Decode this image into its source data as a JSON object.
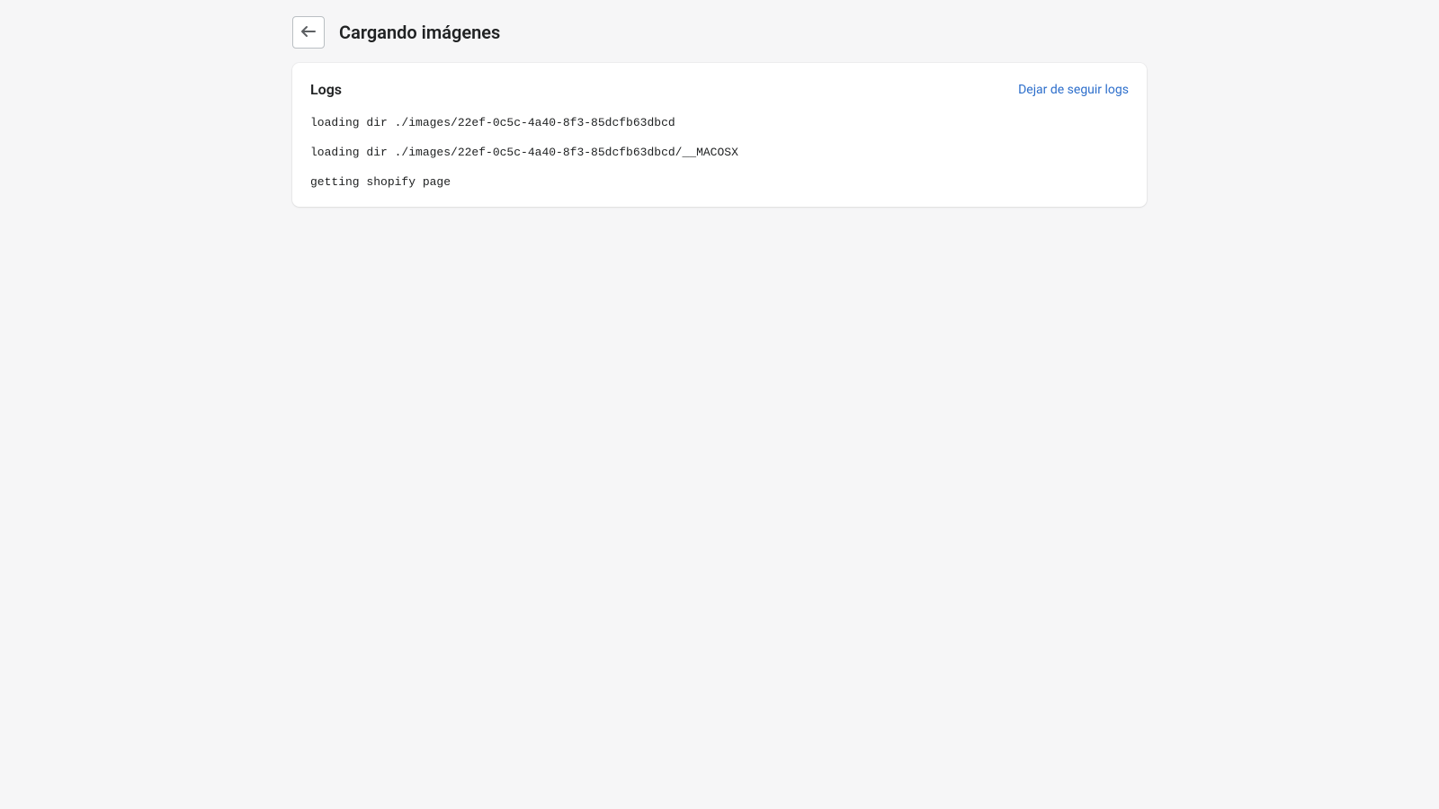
{
  "header": {
    "title": "Cargando imágenes"
  },
  "card": {
    "title": "Logs",
    "action_label": "Dejar de seguir logs"
  },
  "logs": [
    "loading dir ./images/22ef-0c5c-4a40-8f3-85dcfb63dbcd",
    "loading dir ./images/22ef-0c5c-4a40-8f3-85dcfb63dbcd/__MACOSX",
    "getting shopify page"
  ]
}
